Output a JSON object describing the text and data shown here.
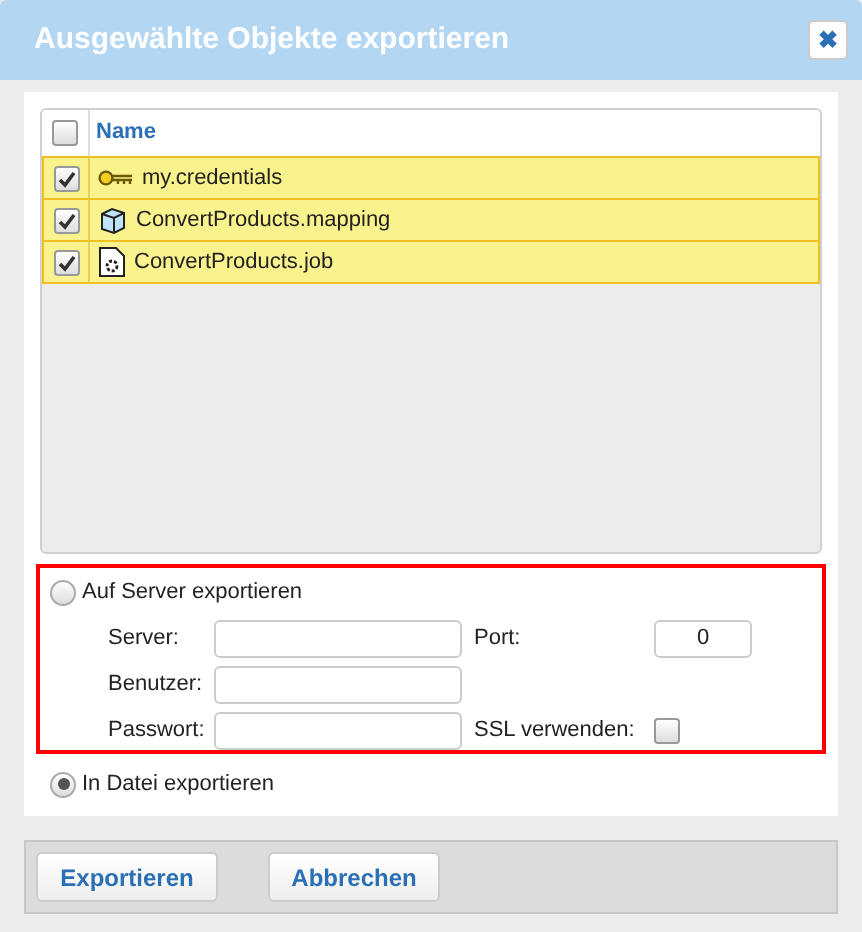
{
  "window": {
    "title": "Ausgewählte Objekte exportieren",
    "close": "✖"
  },
  "table": {
    "header": {
      "label": "Name",
      "checked": false
    },
    "rows": [
      {
        "kind": "key",
        "name": "my.credentials",
        "checked": true
      },
      {
        "kind": "cube",
        "name": "ConvertProducts.mapping",
        "checked": true
      },
      {
        "kind": "job",
        "name": "ConvertProducts.job",
        "checked": true
      }
    ]
  },
  "options": [
    {
      "label": "Auf Server exportieren",
      "selected": false,
      "fields": {
        "server": {
          "label": "Server:"
        },
        "port": {
          "label": "Port:",
          "value": "0"
        },
        "user": {
          "label": "Benutzer:"
        },
        "password": {
          "label": "Passwort:"
        },
        "ssl": {
          "label": "SSL verwenden:",
          "checked": false
        }
      }
    },
    {
      "label": "In Datei exportieren",
      "selected": true
    }
  ],
  "buttons": [
    "Exportieren",
    "Abbrechen"
  ]
}
